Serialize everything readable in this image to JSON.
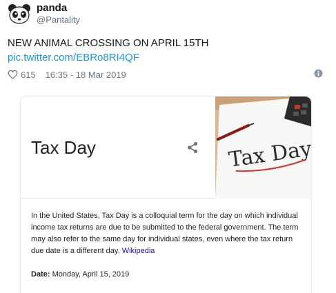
{
  "tweet": {
    "display_name": "panda",
    "handle": "@Pantality",
    "text": "NEW ANIMAL CROSSING ON APRIL 15TH",
    "link": "pic.twitter.com/EBRo8RI4QF",
    "likes": "615",
    "timestamp": "16:35 - 18 Mar 2019"
  },
  "card": {
    "title": "Tax Day",
    "image_text": "Tax Day",
    "description": "In the United States, Tax Day is a colloquial term for the day on which individual income tax returns are due to be submitted to the federal government. The term may also refer to the same day for individual states, even where the tax return due date is a different day.",
    "source_link": "Wikipedia",
    "date_label": "Date:",
    "date_value": "Monday, April 15, 2019"
  },
  "colors": {
    "link": "#1b95e0",
    "muted": "#657786",
    "wiki_link": "#1a0dab"
  },
  "icons": {
    "avatar": "panda-avatar-icon",
    "like": "heart-icon",
    "info": "info-icon",
    "share": "share-icon"
  }
}
